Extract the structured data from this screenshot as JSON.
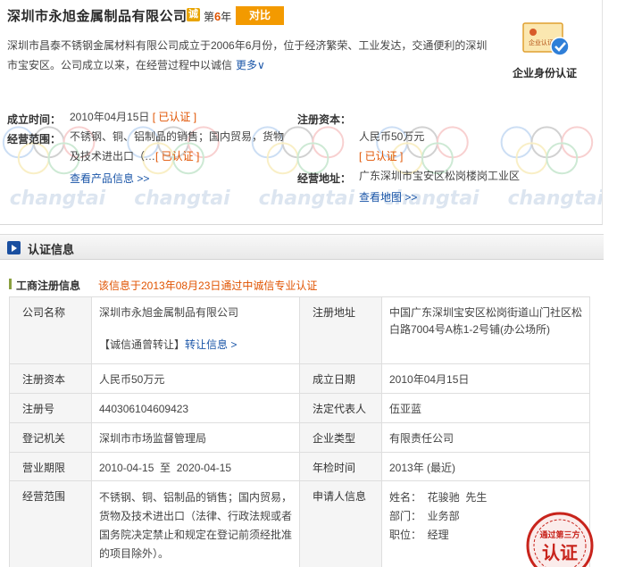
{
  "company": {
    "name": "深圳市永旭金属制品有限公司",
    "cheng_badge": "诚",
    "year_prefix": "第",
    "year_count": "6",
    "year_suffix": "年",
    "compare_button": "对比",
    "intro": "深圳市昌泰不锈钢金属材料有限公司成立于2006年6月份，位于经济繁荣、工业发达，交通便利的深圳市宝安区。公司成立以来，在经营过程中以诚信",
    "more_link": "更多∨",
    "verify_label": "企业身份认证",
    "verify_icon_text": "企业认证"
  },
  "summary": {
    "founded_label": "成立时间：",
    "founded_value": "2010年04月15日",
    "founded_cert": "[ 已认证 ]",
    "capital_label": "注册资本：",
    "capital_value": "人民币50万元",
    "capital_cert": "[ 已认证 ]",
    "scope_label": "经营范围：",
    "scope_value_line1": "不锈钢、铜、铝制品的销售；国内贸易，货物",
    "scope_value_line2": "及技术进出口（…",
    "scope_cert": "[ 已认证 ]",
    "products_link": "查看产品信息 >>",
    "address_label": "经营地址：",
    "address_value": "广东深圳市宝安区松岗楼岗工业区",
    "map_link": "查看地图 >>"
  },
  "watermark_text": "changtai",
  "section": {
    "title": "认证信息"
  },
  "registration": {
    "title": "工商注册信息",
    "note": "该信息于2013年08月23日通过中诚信专业认证",
    "rows": {
      "company_name_label": "公司名称",
      "company_name_value": "深圳市永旭金属制品有限公司",
      "transfer_text": "【诚信通曾转让】",
      "transfer_link": "转让信息 >",
      "reg_address_label": "注册地址",
      "reg_address_value": "中国广东深圳宝安区松岗街道山门社区松白路7004号A栋1-2号铺(办公场所)",
      "capital_label": "注册资本",
      "capital_value": "人民币50万元",
      "founded_label": "成立日期",
      "founded_value": "2010年04月15日",
      "reg_no_label": "注册号",
      "reg_no_value": "440306104609423",
      "legal_rep_label": "法定代表人",
      "legal_rep_value": "伍亚蓝",
      "authority_label": "登记机关",
      "authority_value": "深圳市市场监督管理局",
      "type_label": "企业类型",
      "type_value": "有限责任公司",
      "term_label": "营业期限",
      "term_value": "2010-04-15  至  2020-04-15",
      "inspection_label": "年检时间",
      "inspection_value": "2013年 (最近)",
      "scope_label": "经营范围",
      "scope_value": "不锈钢、铜、铝制品的销售；国内贸易，货物及技术进出口（法律、行政法规或者国务院决定禁止和规定在登记前须经批准的项目除外）。",
      "applicant_label": "申请人信息",
      "applicant_name": "姓名：  花骏驰  先生",
      "applicant_dept": "部门：  业务部",
      "applicant_title": "职位：  经理"
    }
  },
  "stamp": {
    "top_text": "通过第三方",
    "main_text": "认证"
  },
  "colors": {
    "accent_orange": "#f39a00",
    "cert_orange": "#e05300",
    "link_blue": "#1b56a8",
    "section_blue": "#1a4fa0",
    "stamp_red": "#c8241c"
  }
}
